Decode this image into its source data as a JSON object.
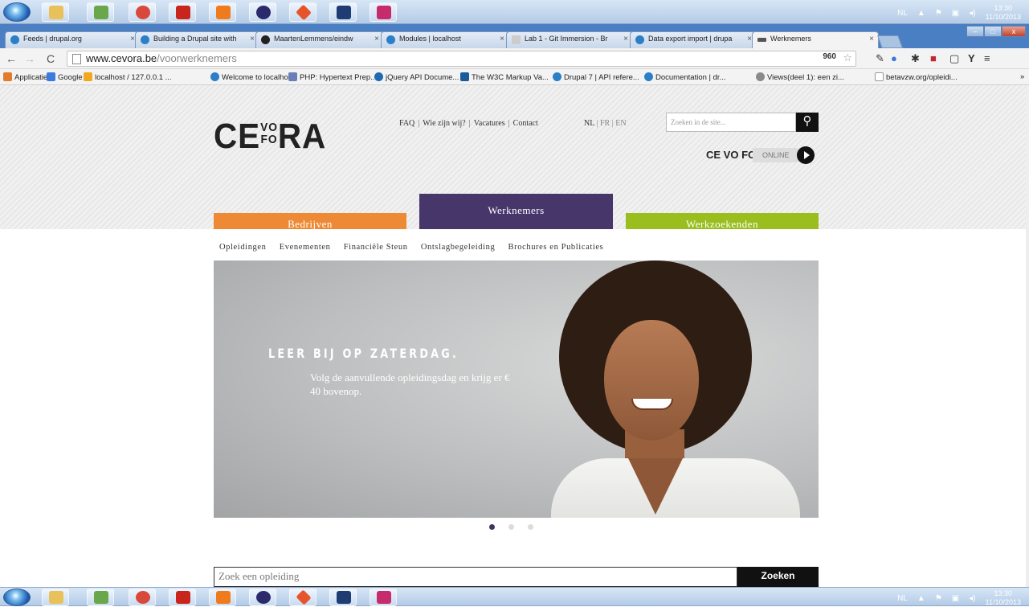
{
  "taskbar": {
    "apps": [
      {
        "name": "explorer-icon",
        "color": "#e8c15a"
      },
      {
        "name": "notepad-icon",
        "color": "#6aa64a"
      },
      {
        "name": "chrome-icon",
        "color": "#d9493b"
      },
      {
        "name": "filezilla-icon",
        "color": "#c8251d"
      },
      {
        "name": "xampp-icon",
        "color": "#f07b1d"
      },
      {
        "name": "eclipse-icon",
        "color": "#2c2a6d"
      },
      {
        "name": "git-icon",
        "color": "#e5542b"
      },
      {
        "name": "photoshop-icon",
        "color": "#1f3d73"
      },
      {
        "name": "indesign-icon",
        "color": "#c62c6b"
      }
    ],
    "lang": "NL",
    "time": "13:30",
    "date": "11/10/2013"
  },
  "tabs": [
    {
      "label": "Feeds | drupal.org",
      "close": "×"
    },
    {
      "label": "Building a Drupal site with",
      "close": "×"
    },
    {
      "label": "MaartenLemmens/eindw",
      "close": "×"
    },
    {
      "label": "Modules | localhost",
      "close": "×"
    },
    {
      "label": "Lab 1 - Git Immersion - Br",
      "close": "×"
    },
    {
      "label": "Data export import | drupa",
      "close": "×"
    },
    {
      "label": "Werknemers",
      "close": "×"
    }
  ],
  "address": {
    "host": "www.cevora.be",
    "path": "/voorwerknemers"
  },
  "bookmarks": [
    "Applicaties",
    "Google",
    "localhost / 127.0.0.1 ...",
    "Welcome to localho...",
    "PHP: Hypertext Prep...",
    "jQuery API Docume...",
    "The W3C Markup Va...",
    "Drupal 7 | API refere...",
    "Documentation | dr...",
    "Views(deel 1): een zi...",
    "betavzw.org/opleidi..."
  ],
  "site": {
    "logo_left": "CE",
    "logo_stack_top": "VO",
    "logo_stack_bottom": "FO",
    "logo_right": "RA",
    "top_links": [
      "FAQ",
      "Wie zijn wij?",
      "Vacatures",
      "Contact"
    ],
    "link_sep": "|",
    "langs": {
      "nl": "NL",
      "fr": "FR",
      "en": "EN",
      "sep": "|"
    },
    "search_placeholder": "Zoeken in de site...",
    "online_brand": "CE VO FO RA",
    "online_label": "ONLINE",
    "main_tabs": {
      "left": "Bedrijven",
      "center": "Werknemers",
      "right": "Werkzoekenden"
    },
    "subnav": [
      "Opleidingen",
      "Evenementen",
      "Financiële Steun",
      "Ontslagbegeleiding",
      "Brochures en Publicaties"
    ],
    "hero_title": "LEER BIJ OP ZATERDAG.",
    "hero_text": "Volg de aanvullende opleidingsdag en krijg er € 40 bovenop.",
    "carousel_count": 3,
    "course_placeholder": "Zoek een opleiding",
    "course_button": "Zoeken"
  }
}
